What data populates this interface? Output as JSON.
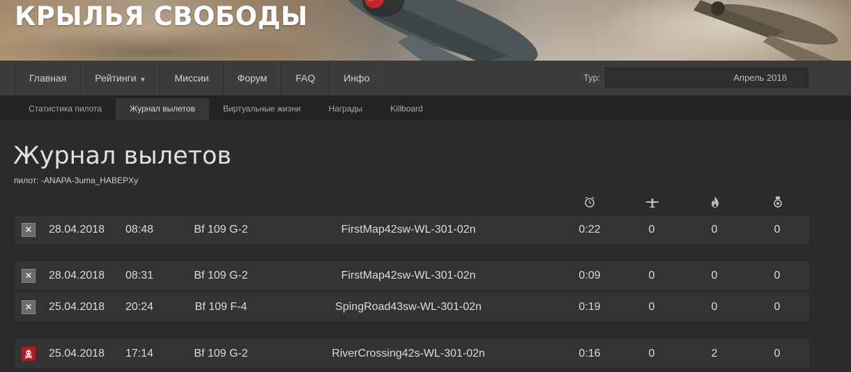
{
  "header": {
    "site_title": "КРЫЛЬЯ СВОБОДЫ"
  },
  "nav": {
    "items": [
      "Главная",
      "Рейтинги",
      "Миссии",
      "Форум",
      "FAQ",
      "Инфо"
    ],
    "tour_label": "Тур:",
    "tour_value": "Апрель 2018"
  },
  "subnav": {
    "items": [
      "Статистика пилота",
      "Журнал вылетов",
      "Виртуальные жизни",
      "Награды",
      "Killboard"
    ],
    "active_index": 1
  },
  "page": {
    "title": "Журнал вылетов",
    "pilot": "пилот: -ANAPA-3uma_HABEPXy"
  },
  "columns": {
    "icons": [
      "clock-icon",
      "aircraft-icon",
      "fire-icon",
      "medal-icon"
    ]
  },
  "sorties": [
    {
      "status": "crashed",
      "status_icon": "crashed-x-icon",
      "date": "28.04.2018",
      "time": "08:48",
      "plane": "Bf 109 G-2",
      "mission": "FirstMap42sw-WL-301-02n",
      "duration": "0:22",
      "air_kills": "0",
      "ground_kills": "0",
      "score": "0"
    },
    {
      "status": "crashed",
      "status_icon": "crashed-x-icon",
      "date": "28.04.2018",
      "time": "08:31",
      "plane": "Bf 109 G-2",
      "mission": "FirstMap42sw-WL-301-02n",
      "duration": "0:09",
      "air_kills": "0",
      "ground_kills": "0",
      "score": "0"
    },
    {
      "status": "crashed",
      "status_icon": "crashed-x-icon",
      "date": "25.04.2018",
      "time": "20:24",
      "plane": "Bf 109 F-4",
      "mission": "SpingRoad43sw-WL-301-02n",
      "duration": "0:19",
      "air_kills": "0",
      "ground_kills": "0",
      "score": "0"
    },
    {
      "status": "killed",
      "status_icon": "skull-icon",
      "date": "25.04.2018",
      "time": "17:14",
      "plane": "Bf 109 G-2",
      "mission": "RiverCrossing42s-WL-301-02n",
      "duration": "0:16",
      "air_kills": "0",
      "ground_kills": "2",
      "score": "0"
    }
  ]
}
